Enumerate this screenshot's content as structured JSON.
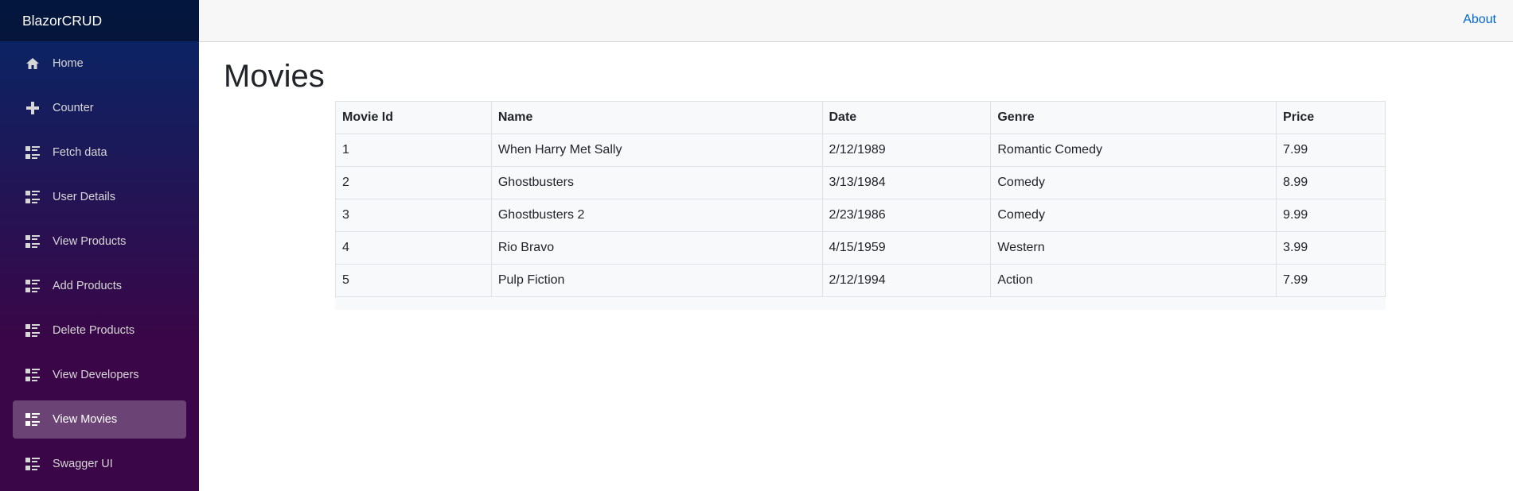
{
  "app": {
    "brand": "BlazorCRUD"
  },
  "sidebar": {
    "items": [
      {
        "label": "Home",
        "icon": "home-icon"
      },
      {
        "label": "Counter",
        "icon": "plus-icon"
      },
      {
        "label": "Fetch data",
        "icon": "list-rich-icon"
      },
      {
        "label": "User Details",
        "icon": "list-rich-icon"
      },
      {
        "label": "View Products",
        "icon": "list-rich-icon"
      },
      {
        "label": "Add Products",
        "icon": "list-rich-icon"
      },
      {
        "label": "Delete Products",
        "icon": "list-rich-icon"
      },
      {
        "label": "View Developers",
        "icon": "list-rich-icon"
      },
      {
        "label": "View Movies",
        "icon": "list-rich-icon",
        "active": true
      },
      {
        "label": "Swagger UI",
        "icon": "list-rich-icon"
      }
    ]
  },
  "topbar": {
    "about": "About"
  },
  "main": {
    "title": "Movies",
    "table": {
      "columns": [
        "Movie Id",
        "Name",
        "Date",
        "Genre",
        "Price"
      ],
      "rows": [
        [
          "1",
          "When Harry Met Sally",
          "2/12/1989",
          "Romantic Comedy",
          "7.99"
        ],
        [
          "2",
          "Ghostbusters",
          "3/13/1984",
          "Comedy",
          "8.99"
        ],
        [
          "3",
          "Ghostbusters 2",
          "2/23/1986",
          "Comedy",
          "9.99"
        ],
        [
          "4",
          "Rio Bravo",
          "4/15/1959",
          "Western",
          "3.99"
        ],
        [
          "5",
          "Pulp Fiction",
          "2/12/1994",
          "Action",
          "7.99"
        ]
      ]
    }
  },
  "colors": {
    "accent_link": "#0366d6",
    "sidebar_top": "#052767",
    "sidebar_bottom": "#3a0647"
  }
}
